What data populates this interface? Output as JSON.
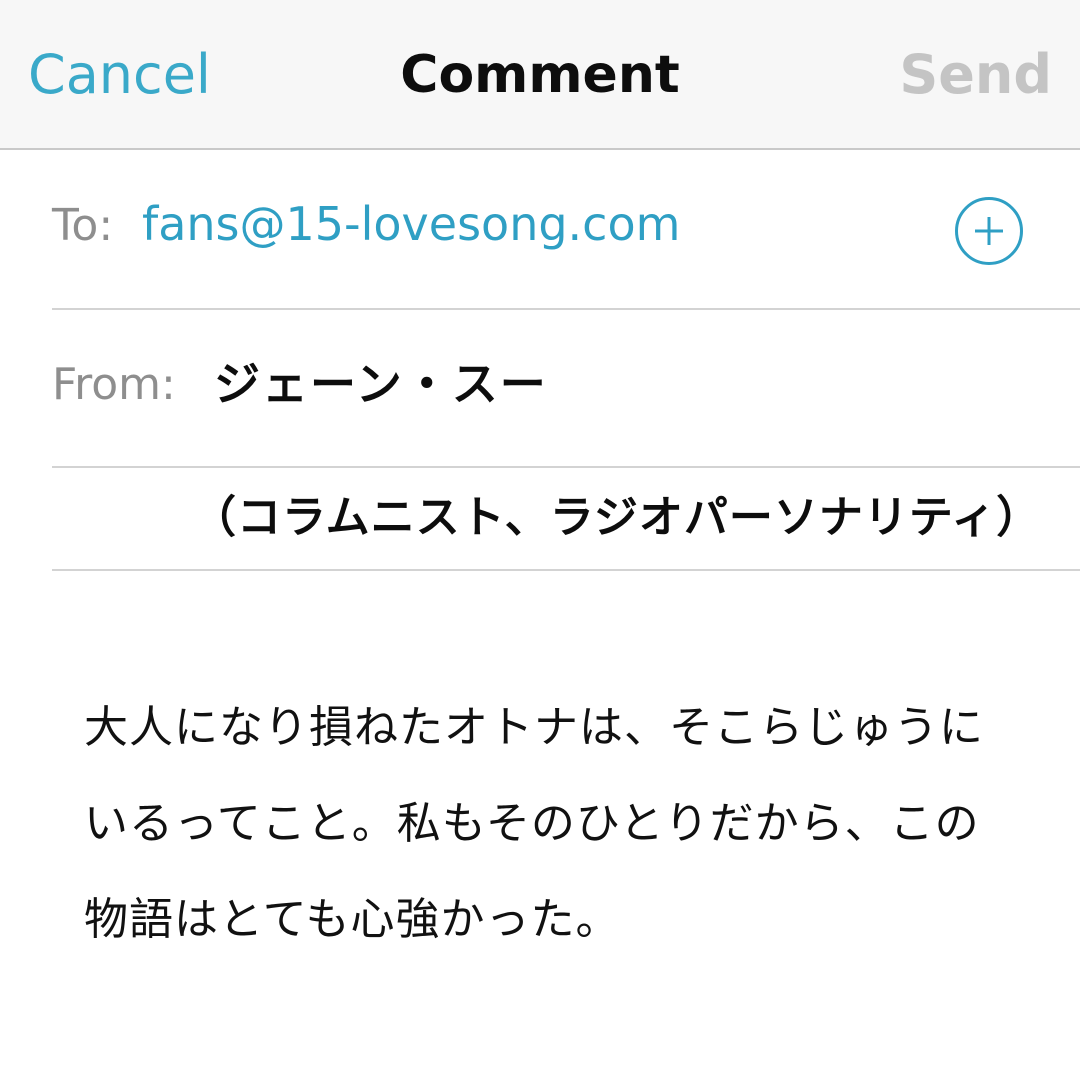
{
  "navbar": {
    "cancel_label": "Cancel",
    "title": "Comment",
    "send_label": "Send"
  },
  "to_field": {
    "label": "To:",
    "value": "fans@15-lovesong.com"
  },
  "from_field": {
    "label": "From:",
    "value": "ジェーン・スー"
  },
  "affiliation": {
    "value": "（コラムニスト、ラジオパーソナリティ）"
  },
  "message": {
    "lines": [
      "大人になり損ねたオトナは、そこらじゅうに",
      "いるってこと。私もそのひとりだから、この",
      "物語はとても心強かった。"
    ]
  },
  "colors": {
    "accent": "#2f9fc4",
    "disabled": "#c4c4c4",
    "label_gray": "#8e8e8e"
  },
  "icons": {
    "add_recipient": "plus-circle-icon"
  }
}
